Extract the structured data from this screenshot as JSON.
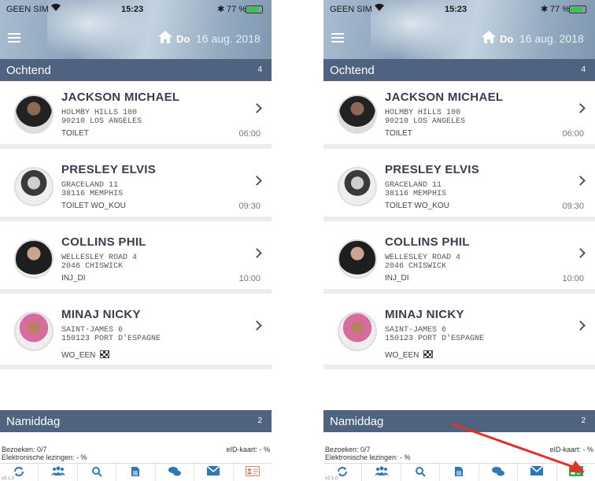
{
  "phones": [
    {
      "status": {
        "carrier": "GEEN SIM",
        "time": "15:23",
        "battery": "77 %"
      },
      "header": {
        "day": "Do",
        "date": "16 aug. 2018"
      },
      "morning": {
        "title": "Ochtend",
        "count": "4"
      },
      "visits": [
        {
          "name": "JACKSON MICHAEL",
          "addr1": "HOLMBY HILLS 100",
          "addr2": "90210 LOS ANGELES",
          "task": "TOILET",
          "time": "06:00"
        },
        {
          "name": "PRESLEY ELVIS",
          "addr1": "GRACELAND 11",
          "addr2": "38116 MEMPHIS",
          "task": "TOILET WO_KOU",
          "time": "09:30"
        },
        {
          "name": "COLLINS PHIL",
          "addr1": "WELLESLEY ROAD 4",
          "addr2": "2046 CHISWICK",
          "task": "INJ_DI",
          "time": "10:00"
        },
        {
          "name": "MINAJ NICKY",
          "addr1": "SAINT-JAMES 6",
          "addr2": "150123 PORT D'ESPAGNE",
          "task": "WO_EEN",
          "time": ""
        }
      ],
      "afternoon": {
        "title": "Namiddag",
        "count": "2"
      },
      "footer": {
        "visits": "Bezoeken: 0/7",
        "readings": "Elektronische lezingen: - %",
        "eid": "eID-kaart: - %"
      },
      "version": "v2.1.0",
      "eid_icon_color": "#d9826b"
    },
    {
      "status": {
        "carrier": "GEEN SIM",
        "time": "15:23",
        "battery": "77 %"
      },
      "header": {
        "day": "Do",
        "date": "16 aug. 2018"
      },
      "morning": {
        "title": "Ochtend",
        "count": "4"
      },
      "visits": [
        {
          "name": "JACKSON MICHAEL",
          "addr1": "HOLMBY HILLS 100",
          "addr2": "90210 LOS ANGELES",
          "task": "TOILET",
          "time": "06:00"
        },
        {
          "name": "PRESLEY ELVIS",
          "addr1": "GRACELAND 11",
          "addr2": "38116 MEMPHIS",
          "task": "TOILET WO_KOU",
          "time": "09:30"
        },
        {
          "name": "COLLINS PHIL",
          "addr1": "WELLESLEY ROAD 4",
          "addr2": "2046 CHISWICK",
          "task": "INJ_DI",
          "time": "10:00"
        },
        {
          "name": "MINAJ NICKY",
          "addr1": "SAINT-JAMES 6",
          "addr2": "150123 PORT D'ESPAGNE",
          "task": "WO_EEN",
          "time": ""
        }
      ],
      "afternoon": {
        "title": "Namiddag",
        "count": "2"
      },
      "footer": {
        "visits": "Bezoeken: 0/7",
        "readings": "Elektronische lezingen: - %",
        "eid": "eID-kaart: - %"
      },
      "version": "v2.1.0",
      "eid_icon_color": "#3aa54a"
    }
  ],
  "colors": {
    "accent": "#2f78b8",
    "section": "#4f6280",
    "arrow": "#e0322a"
  }
}
